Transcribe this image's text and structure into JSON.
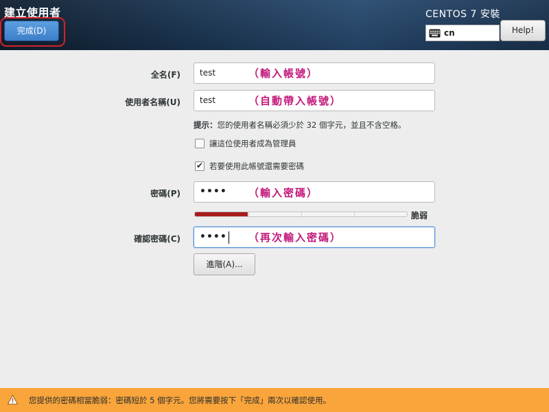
{
  "header": {
    "page_title": "建立使用者",
    "done_label": "完成(D)",
    "product_title": "CENTOS 7 安裝",
    "keyboard_layout": "cn",
    "keyboard_icon": "keyboard-icon",
    "help_label": "Help!"
  },
  "form": {
    "fullname": {
      "label": "全名(F)",
      "value": "test",
      "annotation": "（輸入帳號）"
    },
    "username": {
      "label": "使用者名稱(U)",
      "value": "test",
      "annotation": "（自動帶入帳號）"
    },
    "hint": {
      "prefix": "提示：",
      "text": "您的使用者名稱必須少於 32 個字元，並且不含空格。"
    },
    "admin_checkbox": {
      "label": "讓這位使用者成為管理員",
      "checked": false
    },
    "require_password_checkbox": {
      "label": "若要使用此帳號還需要密碼",
      "checked": true
    },
    "password": {
      "label": "密碼(P)",
      "value": "••••",
      "annotation": "（輸入密碼）"
    },
    "strength": {
      "level": 0.25,
      "label": "脆弱",
      "color": "#a81c1c"
    },
    "confirm": {
      "label": "確認密碼(C)",
      "value": "••••",
      "annotation": "（再次輸入密碼）"
    },
    "advanced_label": "進階(A)..."
  },
  "warning": {
    "icon": "warning-icon",
    "text": "您提供的密碼相當脆弱：密碼短於 5 個字元。您將需要按下「完成」兩次以確認使用。",
    "color": "#f9a53b"
  },
  "colors": {
    "header_bg": "#1a3552",
    "done_button": "#3c7fc9",
    "highlight_ring": "#d2232a",
    "annotation": "#c2187a"
  }
}
